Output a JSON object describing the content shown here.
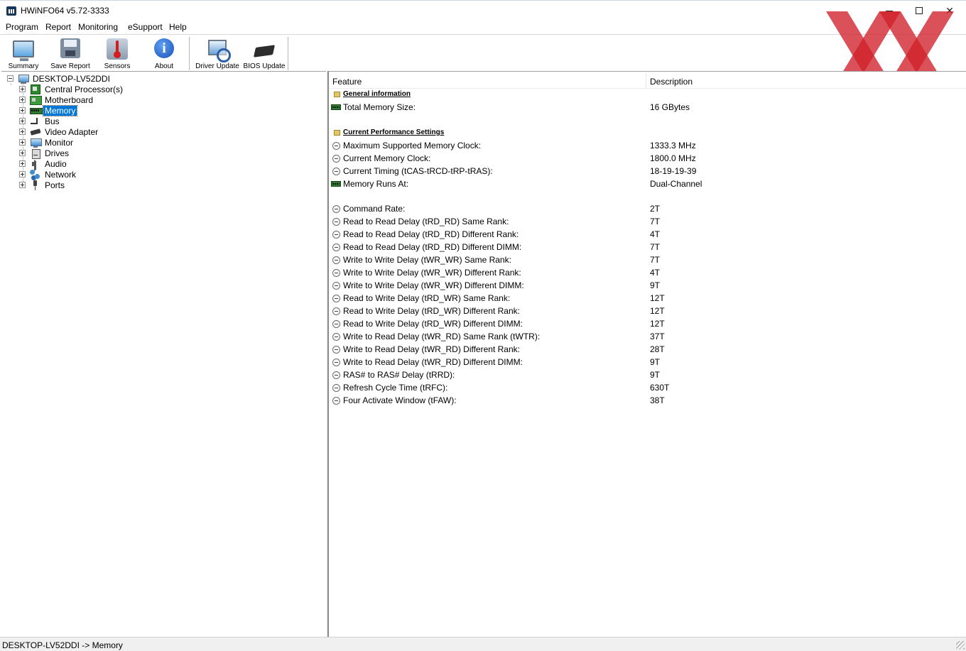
{
  "window": {
    "title": "HWiNFO64 v5.72-3333",
    "minimize_icon": "minimize-icon",
    "maximize_icon": "maximize-icon",
    "close_glyph": "✕"
  },
  "menu": [
    "Program",
    "Report",
    "Monitoring",
    "eSupport",
    "Help"
  ],
  "toolbar": {
    "summary": "Summary",
    "save_report": "Save Report",
    "sensors": "Sensors",
    "about": "About",
    "driver_update": "Driver Update",
    "bios_update": "BIOS Update"
  },
  "watermark": {
    "color": "#d0202a"
  },
  "tree": {
    "root": "DESKTOP-LV52DDI",
    "items": [
      {
        "label": "Central Processor(s)",
        "icon": "cpu-icon"
      },
      {
        "label": "Motherboard",
        "icon": "motherboard-icon"
      },
      {
        "label": "Memory",
        "icon": "memory-icon",
        "selected": true
      },
      {
        "label": "Bus",
        "icon": "bus-icon"
      },
      {
        "label": "Video Adapter",
        "icon": "video-adapter-icon"
      },
      {
        "label": "Monitor",
        "icon": "monitor-icon"
      },
      {
        "label": "Drives",
        "icon": "drives-icon"
      },
      {
        "label": "Audio",
        "icon": "audio-icon"
      },
      {
        "label": "Network",
        "icon": "network-icon"
      },
      {
        "label": "Ports",
        "icon": "ports-icon"
      }
    ]
  },
  "details": {
    "columns": {
      "feature": "Feature",
      "description": "Description"
    },
    "general_section": "General information",
    "total_memory_label": "Total Memory Size:",
    "total_memory_value": "16 GBytes",
    "perf_section": "Current Performance Settings",
    "perf_rows": [
      {
        "feature": "Maximum Supported Memory Clock:",
        "value": "1333.3 MHz",
        "icon": "clock-icon"
      },
      {
        "feature": "Current Memory Clock:",
        "value": "1800.0 MHz",
        "icon": "clock-icon"
      },
      {
        "feature": "Current Timing (tCAS-tRCD-tRP-tRAS):",
        "value": "18-19-19-39",
        "icon": "clock-icon"
      },
      {
        "feature": "Memory Runs At:",
        "value": "Dual-Channel",
        "icon": "ram-icon"
      }
    ],
    "timing_rows": [
      {
        "feature": "Command Rate:",
        "value": "2T"
      },
      {
        "feature": "Read to Read Delay (tRD_RD) Same Rank:",
        "value": "7T"
      },
      {
        "feature": "Read to Read Delay (tRD_RD) Different Rank:",
        "value": "4T"
      },
      {
        "feature": "Read to Read Delay (tRD_RD) Different DIMM:",
        "value": "7T"
      },
      {
        "feature": "Write to Write Delay (tWR_WR) Same Rank:",
        "value": "7T"
      },
      {
        "feature": "Write to Write Delay (tWR_WR) Different Rank:",
        "value": "4T"
      },
      {
        "feature": "Write to Write Delay (tWR_WR) Different DIMM:",
        "value": "9T"
      },
      {
        "feature": "Read to Write Delay (tRD_WR) Same Rank:",
        "value": "12T"
      },
      {
        "feature": "Read to Write Delay (tRD_WR) Different Rank:",
        "value": "12T"
      },
      {
        "feature": "Read to Write Delay (tRD_WR) Different DIMM:",
        "value": "12T"
      },
      {
        "feature": "Write to Read Delay (tWR_RD) Same Rank (tWTR):",
        "value": "37T"
      },
      {
        "feature": "Write to Read Delay (tWR_RD) Different Rank:",
        "value": "28T"
      },
      {
        "feature": "Write to Read Delay (tWR_RD) Different DIMM:",
        "value": "9T"
      },
      {
        "feature": "RAS# to RAS# Delay (tRRD):",
        "value": "9T"
      },
      {
        "feature": "Refresh Cycle Time (tRFC):",
        "value": "630T"
      },
      {
        "feature": "Four Activate Window (tFAW):",
        "value": "38T"
      }
    ]
  },
  "status": {
    "text": "DESKTOP-LV52DDI -> Memory"
  }
}
